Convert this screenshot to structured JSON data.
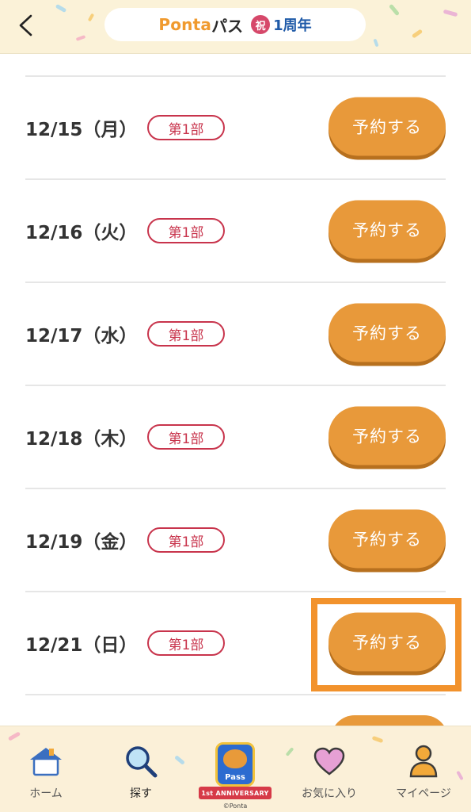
{
  "header": {
    "back_icon": "chevron-left-icon",
    "logo": {
      "brand": "Ponta",
      "suffix": "パス",
      "iwai": "祝",
      "anniversary": "1周年"
    }
  },
  "reservations": [
    {
      "date": "12/15（月）",
      "part": "第1部",
      "button": "予約する"
    },
    {
      "date": "12/16（火）",
      "part": "第1部",
      "button": "予約する"
    },
    {
      "date": "12/17（水）",
      "part": "第1部",
      "button": "予約する"
    },
    {
      "date": "12/18（木）",
      "part": "第1部",
      "button": "予約する"
    },
    {
      "date": "12/19（金）",
      "part": "第1部",
      "button": "予約する"
    },
    {
      "date": "12/21（日）",
      "part": "第1部",
      "button": "予約する"
    }
  ],
  "highlighted_row": 5,
  "bottom_nav": {
    "items": [
      {
        "label": "ホーム",
        "icon": "home-icon"
      },
      {
        "label": "探す",
        "icon": "search-icon"
      },
      {
        "label": "お気に入り",
        "icon": "heart-icon"
      },
      {
        "label": "マイページ",
        "icon": "person-icon"
      }
    ],
    "center": {
      "pass": "Pass",
      "ribbon": "1st ANNIVERSARY",
      "copyright": "©Ponta"
    }
  },
  "colors": {
    "accent_orange": "#e8993a",
    "badge_red": "#c8344c",
    "highlight": "#f2922c",
    "header_bg": "#fbf2d8"
  }
}
